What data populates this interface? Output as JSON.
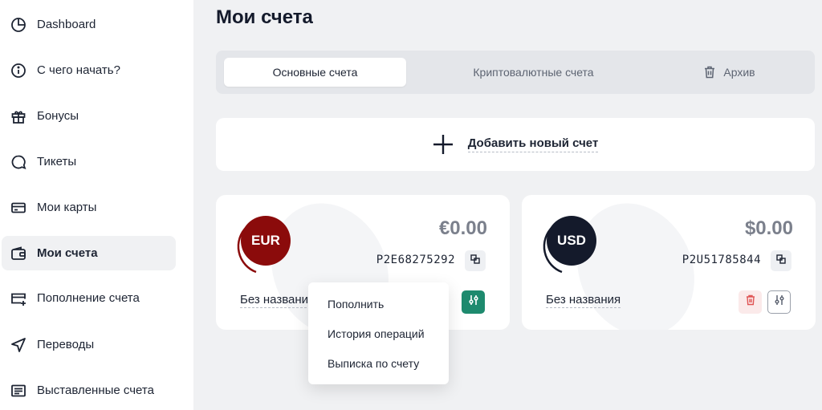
{
  "sidebar": {
    "items": [
      {
        "label": "Dashboard",
        "icon": "pie-chart-icon"
      },
      {
        "label": "С чего начать?",
        "icon": "info-icon"
      },
      {
        "label": "Бонусы",
        "icon": "gift-icon"
      },
      {
        "label": "Тикеты",
        "icon": "chat-bubble-icon"
      },
      {
        "label": "Мои карты",
        "icon": "credit-card-icon"
      },
      {
        "label": "Мои счета",
        "icon": "wallet-icon",
        "active": true
      },
      {
        "label": "Пополнение счета",
        "icon": "card-plus-icon"
      },
      {
        "label": "Переводы",
        "icon": "send-arrow-icon"
      },
      {
        "label": "Выставленные счета",
        "icon": "invoice-icon"
      }
    ]
  },
  "main": {
    "title": "Мои счета",
    "tabs": [
      {
        "label": "Основные счета",
        "active": true
      },
      {
        "label": "Криптовалютные счета"
      },
      {
        "label": "Архив",
        "icon": "trash-icon"
      }
    ],
    "add_account_label": "Добавить новый счет",
    "accounts": [
      {
        "currency": "EUR",
        "badge_color": "#8b0b0b",
        "balance": "€0.00",
        "number": "P2E68275292",
        "name": "Без названия"
      },
      {
        "currency": "USD",
        "badge_color": "#141a2b",
        "balance": "$0.00",
        "number": "P2U51785844",
        "name": "Без названия"
      }
    ],
    "dropdown": [
      "Пополнить",
      "История операций",
      "Выписка по счету"
    ]
  },
  "colors": {
    "accent_green": "#1e8a6e",
    "delete_red": "#e05555",
    "background": "#f0f1f3"
  }
}
